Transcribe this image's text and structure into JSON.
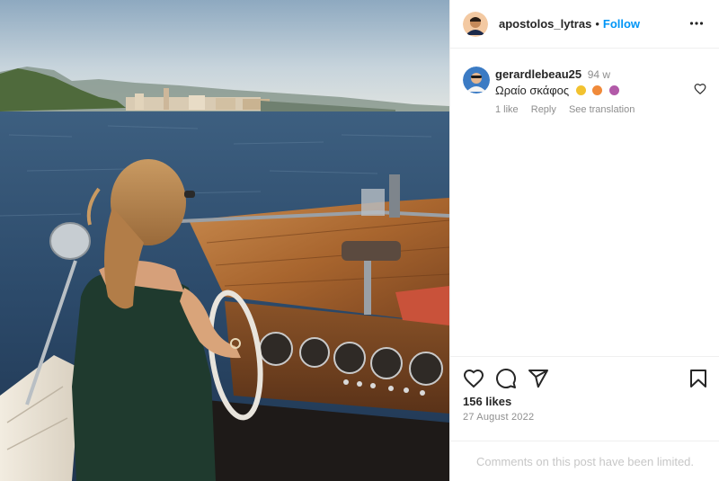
{
  "post": {
    "author": {
      "username": "apostolos_lytras",
      "separator": "•",
      "follow_label": "Follow"
    },
    "photo": {
      "description_icon": "boat-photo"
    },
    "comments": [
      {
        "username": "gerardlebeau25",
        "time": "94 w",
        "text": "Ωραίο σκάφος",
        "emoji_colors": [
          "#f2c230",
          "#f08a3a",
          "#b25aa8"
        ],
        "likes_label": "1 like",
        "reply_label": "Reply",
        "translate_label": "See translation"
      }
    ],
    "likes": "156 likes",
    "date": "27 August 2022",
    "comments_limited": "Comments on this post have been limited."
  },
  "colors": {
    "accent": "#0095f6",
    "text": "#262626",
    "muted": "#8e8e8e",
    "divider": "#efefef"
  }
}
